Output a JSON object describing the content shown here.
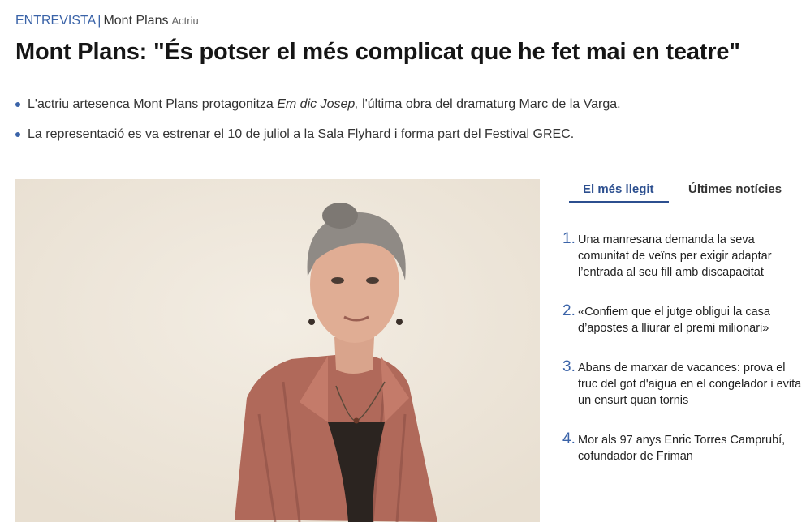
{
  "kicker": {
    "section": "ENTREVISTA",
    "separator": "|",
    "person": "Mont Plans",
    "role": "Actriu"
  },
  "headline": "Mont Plans: \"És potser el més complicat que he fet mai en teatre\"",
  "bullets": [
    {
      "before": "L'actriu artesenca Mont Plans protagonitza ",
      "italic": "Em dic Josep,",
      "after": " l'última obra del dramaturg Marc de la Varga."
    },
    {
      "before": "La representació es va estrenar el 10 de juliol a la Sala Flyhard i forma part del Festival GREC.",
      "italic": "",
      "after": ""
    }
  ],
  "sidebar": {
    "tabs": [
      "El més llegit",
      "Últimes notícies"
    ],
    "items": [
      {
        "num": "1.",
        "title": "Una manresana demanda la seva comunitat de veïns per exigir adaptar l’entrada al seu fill amb discapacitat"
      },
      {
        "num": "2.",
        "title": "«Confiem que el jutge obligui la casa d’apostes a lliurar el premi milionari»"
      },
      {
        "num": "3.",
        "title": "Abans de marxar de vacances: prova el truc del got d'aigua en el congelador i evita un ensurt quan tornis"
      },
      {
        "num": "4.",
        "title": "Mor als 97 anys Enric Torres Camprubí, cofundador de Friman"
      }
    ]
  },
  "colors": {
    "accent": "#3a63a8",
    "tab_active": "#2c4f8f",
    "photo_background": "#efe8dc",
    "shirt": "#b0695a"
  }
}
